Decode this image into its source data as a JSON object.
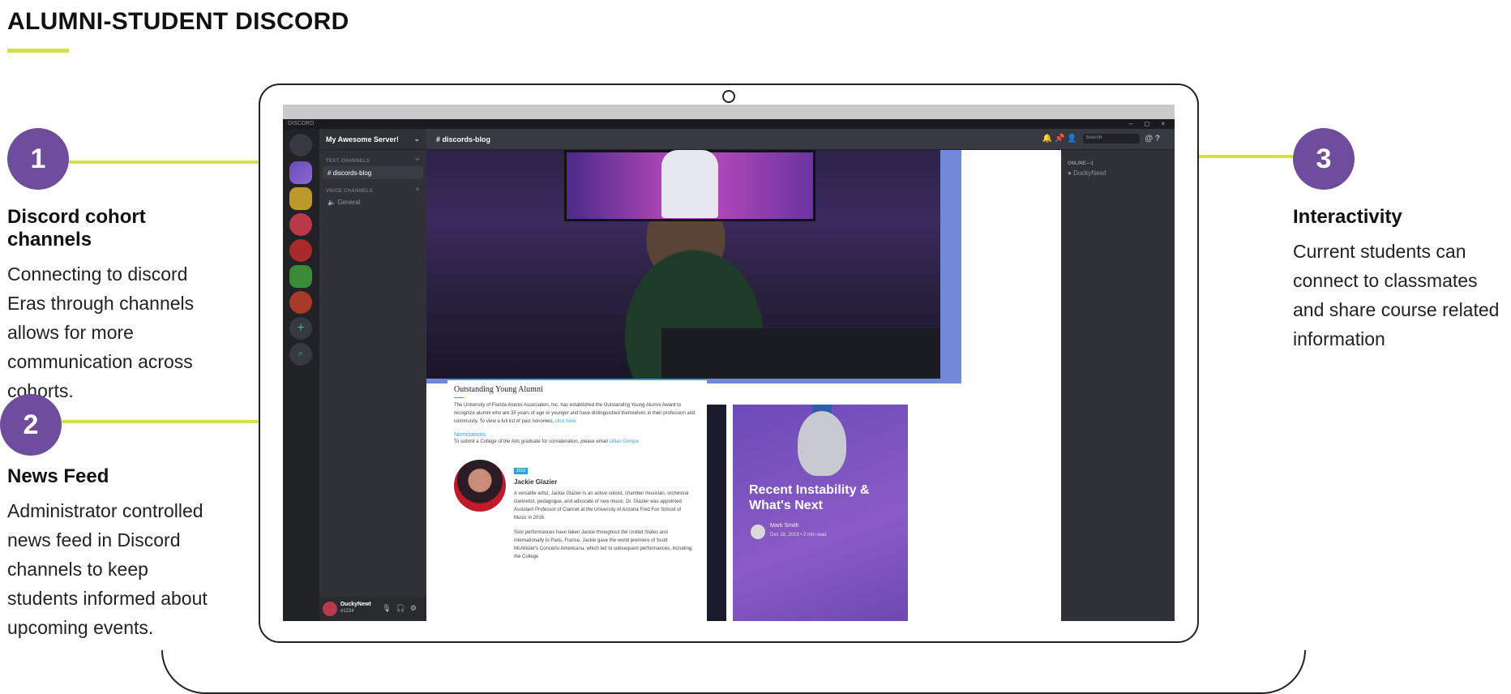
{
  "page": {
    "title": "ALUMNI-STUDENT DISCORD"
  },
  "annotations": [
    {
      "number": "1",
      "heading": "Discord cohort channels",
      "lines": [
        "Connecting to discord",
        "Eras through channels",
        "allows for more",
        "communication across",
        "cohorts."
      ]
    },
    {
      "number": "2",
      "heading": "News Feed",
      "lines": [
        "Administrator controlled",
        "news feed in Discord",
        "channels to keep",
        "students informed about",
        "upcoming events."
      ]
    },
    {
      "number": "3",
      "heading": "Interactivity",
      "lines": [
        "Current students can",
        "connect to classmates",
        "and share course related",
        "information"
      ]
    }
  ],
  "colors": {
    "accent": "#d4e04a",
    "badge": "#6e4d9c",
    "blurple": "#7289da"
  },
  "discord": {
    "window_title": "DISCORD",
    "window_controls": "– ◻ ×",
    "server_name": "My Awesome Server!",
    "text_category": "TEXT CHANNELS",
    "voice_category": "VOICE CHANNELS",
    "active_channel": "discords-blog",
    "voice_channel": "General",
    "channel_header": "discords-blog",
    "search_placeholder": "Search",
    "online_label": "ONLINE—1",
    "member_name": "DuckyNewt",
    "user_name": "DuckyNewt",
    "user_tag": "#1234"
  },
  "article": {
    "title": "Outstanding Young Alumni",
    "intro": "The University of Florida Alumni Association, Inc. has established the Outstanding Young Alumni Award to recognize alumni who are 35 years of age or younger and have distinguished themselves in their profession and community. To view a full list of past honorees,",
    "intro_link": "click here.",
    "nominations": "Nominations",
    "submit_text": "To submit a College of the Arts graduate for consideration, please email",
    "submit_link": "Lillian Dompe.",
    "badge_year": "2016",
    "person_name": "Jackie Glazier",
    "bio1": "A versatile artist, Jackie Glazier is an active soloist, chamber musician, orchestral clarinetist, pedagogue, and advocate of new music. Dr. Glazier was appointed Assistant Professor of Clarinet at the University of Arizona Fred Fox School of Music in 2016.",
    "bio2": "Solo performances have taken Jackie throughout the United States and internationally to Paris, France. Jackie gave the world premiere of Scott McAllister's Concerto Americana, which led to subsequent performances, including the College"
  },
  "blog_card": {
    "title": "Recent Instability & What's Next",
    "author": "Mark Smith",
    "date": "Dec 18, 2019 • 2 min read"
  }
}
